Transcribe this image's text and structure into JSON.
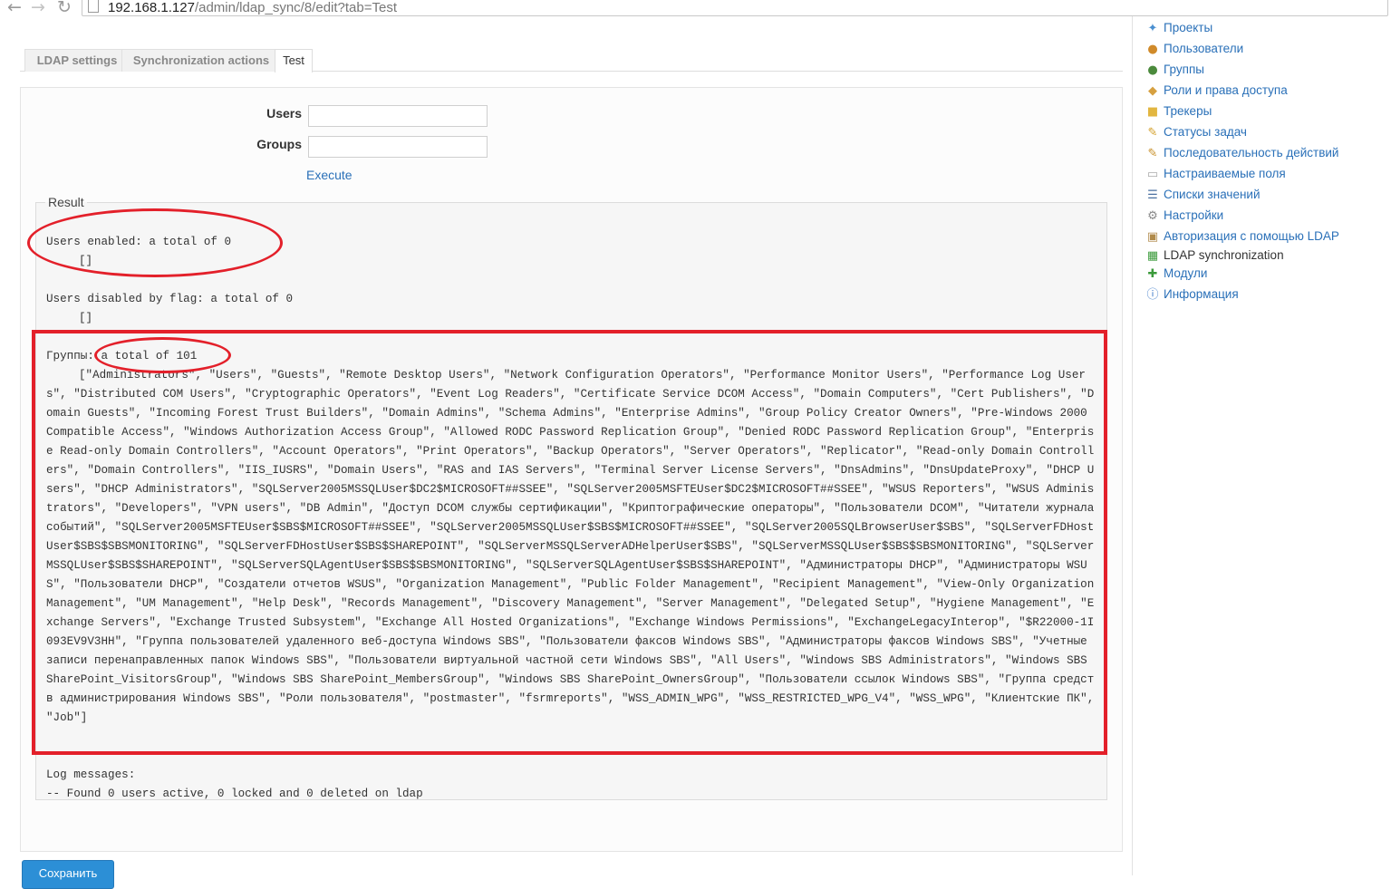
{
  "browser": {
    "url_host": "192.168.1.127",
    "url_path": "/admin/ldap_sync/8/edit?tab=Test"
  },
  "tabs": [
    {
      "label": "LDAP settings"
    },
    {
      "label": "Synchronization actions"
    },
    {
      "label": "Test"
    }
  ],
  "form": {
    "users_label": "Users",
    "groups_label": "Groups",
    "users_value": "",
    "groups_value": "",
    "execute_label": "Execute"
  },
  "result": {
    "legend": "Result",
    "users_enabled": "Users enabled: a total of 0",
    "users_enabled_list": "[]",
    "users_disabled": "Users disabled by flag: a total of 0",
    "users_disabled_list": "[]",
    "groups_prefix": "Группы:",
    "groups_total": " a total of 101",
    "groups_list": "[\"Administrators\", \"Users\", \"Guests\", \"Remote Desktop Users\", \"Network Configuration Operators\", \"Performance Monitor Users\", \"Performance Log Users\", \"Distributed COM Users\", \"Cryptographic Operators\", \"Event Log Readers\", \"Certificate Service DCOM Access\", \"Domain Computers\", \"Cert Publishers\", \"Domain Guests\", \"Incoming Forest Trust Builders\", \"Domain Admins\", \"Schema Admins\", \"Enterprise Admins\", \"Group Policy Creator Owners\", \"Pre-Windows 2000 Compatible Access\", \"Windows Authorization Access Group\", \"Allowed RODC Password Replication Group\", \"Denied RODC Password Replication Group\", \"Enterprise Read-only Domain Controllers\", \"Account Operators\", \"Print Operators\", \"Backup Operators\", \"Server Operators\", \"Replicator\", \"Read-only Domain Controllers\", \"Domain Controllers\", \"IIS_IUSRS\", \"Domain Users\", \"RAS and IAS Servers\", \"Terminal Server License Servers\", \"DnsAdmins\", \"DnsUpdateProxy\", \"DHCP Users\", \"DHCP Administrators\", \"SQLServer2005MSSQLUser$DC2$MICROSOFT##SSEE\", \"SQLServer2005MSFTEUser$DC2$MICROSOFT##SSEE\", \"WSUS Reporters\", \"WSUS Administrators\", \"Developers\", \"VPN users\", \"DB Admin\", \"Доступ DCOM службы сертификации\", \"Криптографические операторы\", \"Пользователи DCOM\", \"Читатели журнала событий\", \"SQLServer2005MSFTEUser$SBS$MICROSOFT##SSEE\", \"SQLServer2005MSSQLUser$SBS$MICROSOFT##SSEE\", \"SQLServer2005SQLBrowserUser$SBS\", \"SQLServerFDHostUser$SBS$SBSMONITORING\", \"SQLServerFDHostUser$SBS$SHAREPOINT\", \"SQLServerMSSQLServerADHelperUser$SBS\", \"SQLServerMSSQLUser$SBS$SBSMONITORING\", \"SQLServerMSSQLUser$SBS$SHAREPOINT\", \"SQLServerSQLAgentUser$SBS$SBSMONITORING\", \"SQLServerSQLAgentUser$SBS$SHAREPOINT\", \"Администраторы DHCP\", \"Администраторы WSUS\", \"Пользователи DHCP\", \"Создатели отчетов WSUS\", \"Organization Management\", \"Public Folder Management\", \"Recipient Management\", \"View-Only Organization Management\", \"UM Management\", \"Help Desk\", \"Records Management\", \"Discovery Management\", \"Server Management\", \"Delegated Setup\", \"Hygiene Management\", \"Exchange Servers\", \"Exchange Trusted Subsystem\", \"Exchange All Hosted Organizations\", \"Exchange Windows Permissions\", \"ExchangeLegacyInterop\", \"$R22000-1I093EV9V3HH\", \"Группа пользователей удаленного веб-доступа Windows SBS\", \"Пользователи факсов Windows SBS\", \"Администраторы факсов Windows SBS\", \"Учетные записи перенаправленных папок Windows SBS\", \"Пользователи виртуальной частной сети Windows SBS\", \"All Users\", \"Windows SBS Administrators\", \"Windows SBS SharePoint_VisitorsGroup\", \"Windows SBS SharePoint_MembersGroup\", \"Windows SBS SharePoint_OwnersGroup\", \"Пользователи ссылок Windows SBS\", \"Группа средств администрирования Windows SBS\", \"Роли пользователя\", \"postmaster\", \"fsrmreports\", \"WSS_ADMIN_WPG\", \"WSS_RESTRICTED_WPG_V4\", \"WSS_WPG\", \"Клиентские ПК\", \"Job\"]",
    "log_title": "Log messages:",
    "log_line": "-- Found 0 users active, 0 locked and 0 deleted on ldap"
  },
  "save_label": "Сохранить",
  "sidebar": {
    "items": [
      {
        "label": "Проекты",
        "icon": "projects-icon"
      },
      {
        "label": "Пользователи",
        "icon": "users-icon"
      },
      {
        "label": "Группы",
        "icon": "groups-icon"
      },
      {
        "label": "Роли и права доступа",
        "icon": "roles-icon"
      },
      {
        "label": "Трекеры",
        "icon": "trackers-icon"
      },
      {
        "label": "Статусы задач",
        "icon": "issue-statuses-icon"
      },
      {
        "label": "Последовательность действий",
        "icon": "workflow-icon"
      },
      {
        "label": "Настраиваемые поля",
        "icon": "custom-fields-icon"
      },
      {
        "label": "Списки значений",
        "icon": "enumerations-icon"
      },
      {
        "label": "Настройки",
        "icon": "settings-icon"
      },
      {
        "label": "Авторизация с помощью LDAP",
        "icon": "ldap-auth-icon"
      },
      {
        "label": "LDAP synchronization",
        "icon": "ldap-sync-icon"
      },
      {
        "label": "Модули",
        "icon": "plugins-icon"
      },
      {
        "label": "Информация",
        "icon": "info-icon"
      }
    ]
  },
  "colors": {
    "link": "#2a70b8",
    "highlight": "#e3202a",
    "save_button": "#2c8fd6"
  }
}
